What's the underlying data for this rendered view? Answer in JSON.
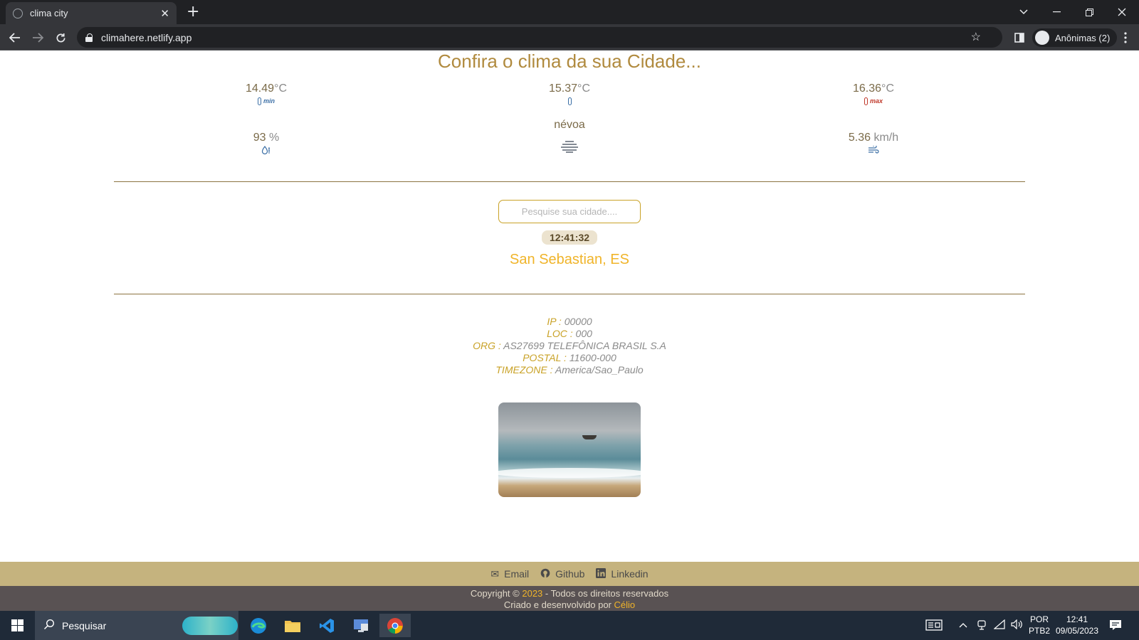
{
  "browser": {
    "tab_title": "clima city",
    "tab_close": "✕",
    "new_tab": "+",
    "url": "climahere.netlify.app",
    "profile_label": "Anônimas (2)",
    "icons": [
      "back-arrow-icon",
      "forward-arrow-icon",
      "reload-icon",
      "lock-icon",
      "star-icon",
      "side-panel-icon",
      "incognito-icon",
      "kebab-menu-icon"
    ]
  },
  "page": {
    "title": "Confira o clima da sua Cidade...",
    "weather": {
      "temp_min": "14.49",
      "temp_min_unit": "°C",
      "temp_min_label": "min",
      "temp_now": "15.37",
      "temp_now_unit": "°C",
      "temp_max": "16.36",
      "temp_max_unit": "°C",
      "temp_max_label": "max",
      "humidity": "93",
      "humidity_unit": "%",
      "description": "névoa",
      "wind": "5.36",
      "wind_unit": "km/h"
    },
    "search_placeholder": "Pesquise sua cidade....",
    "clock": "12:41:32",
    "city": "San Sebastian, ES",
    "ip_info": [
      {
        "key": "IP :",
        "value": "00000"
      },
      {
        "key": "LOC :",
        "value": "000"
      },
      {
        "key": "ORG :",
        "value": "AS27699 TELEFÔNICA BRASIL S.A"
      },
      {
        "key": "POSTAL :",
        "value": "11600-000"
      },
      {
        "key": "TIMEZONE :",
        "value": "America/Sao_Paulo"
      }
    ]
  },
  "footer": {
    "links": [
      {
        "label": "Email",
        "icon": "envelope-icon"
      },
      {
        "label": "Github",
        "icon": "github-icon"
      },
      {
        "label": "Linkedin",
        "icon": "linkedin-icon"
      }
    ],
    "copyright_prefix": "Copyright ©",
    "copyright_year": "2023",
    "copyright_suffix": "- Todos os direitos reservados",
    "credit_prefix": "Criado e desenvolvido por",
    "credit_name": "Célio"
  },
  "taskbar": {
    "search_label": "Pesquisar",
    "lang_top": "POR",
    "lang_bottom": "PTB2",
    "time": "12:41",
    "date": "09/05/2023"
  },
  "colors": {
    "accent": "#b08a3e",
    "city": "#f0b429",
    "footer_light": "#c5b37e",
    "footer_dark": "#595253"
  }
}
